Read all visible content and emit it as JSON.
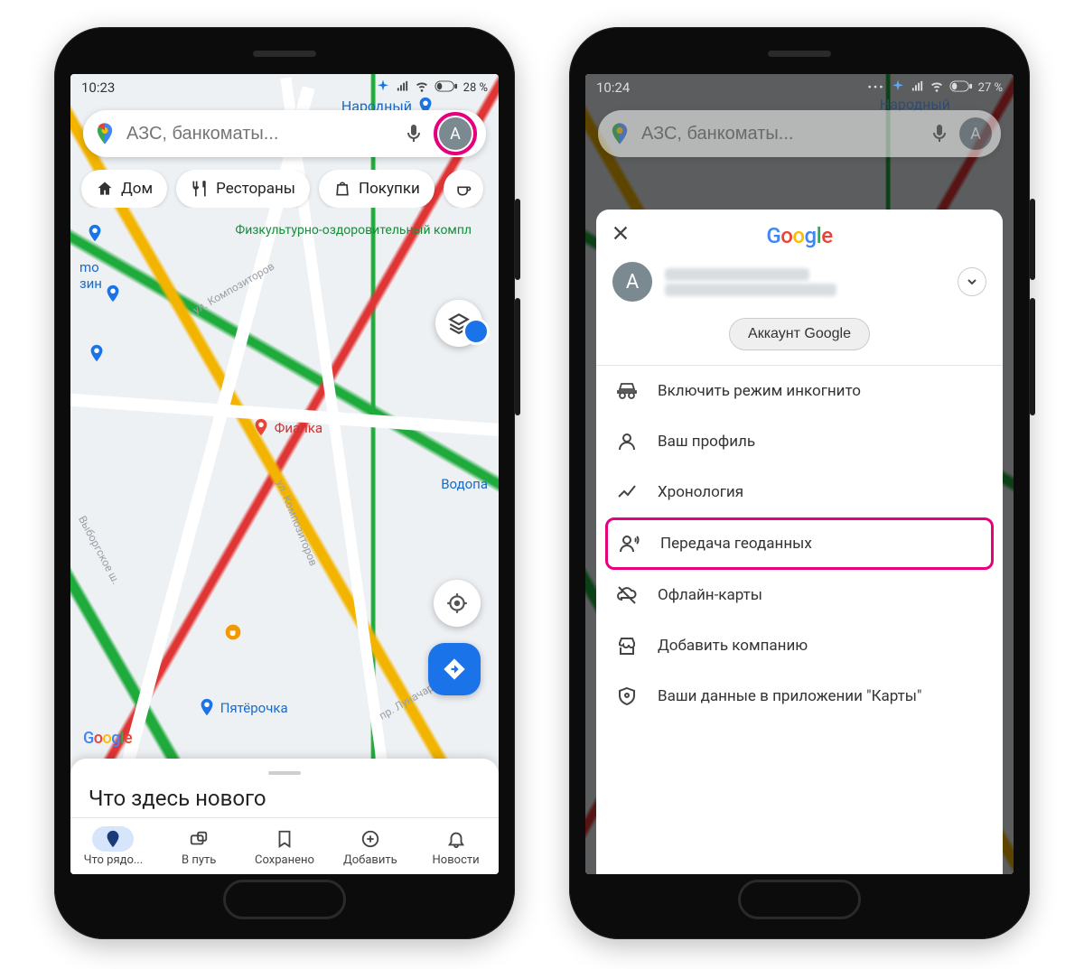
{
  "phone1": {
    "time": "10:23",
    "battery": "28 %",
    "search_placeholder": "АЗС, банкоматы...",
    "avatar_letter": "А",
    "chips": {
      "home": "Дом",
      "restaurants": "Рестораны",
      "shopping": "Покупки"
    },
    "map_labels": {
      "narodny": "Народный",
      "fitness": "Физкультурно-оздоровительный компл",
      "fialka": "Фиалка",
      "vodopa": "Водопа",
      "pyaterochka": "Пятёрочка",
      "mo_shop": "mo\nзин",
      "street1": "ул. Композиторов",
      "street2": "ул. Композиторов",
      "street3": "Выборгское ш.",
      "street4": "пр. Луначарского"
    },
    "card_title": "Что здесь нового",
    "nav": {
      "explore": "Что рядо...",
      "go": "В путь",
      "saved": "Сохранено",
      "contribute": "Добавить",
      "updates": "Новости"
    }
  },
  "phone2": {
    "time": "10:24",
    "battery": "27 %",
    "search_placeholder": "АЗС, банкоматы...",
    "avatar_letter": "А",
    "account_btn": "Аккаунт Google",
    "menu": {
      "incognito": "Включить режим инкогнито",
      "profile": "Ваш профиль",
      "timeline": "Хронология",
      "location_share": "Передача геоданных",
      "offline": "Офлайн-карты",
      "add_business": "Добавить компанию",
      "your_data": "Ваши данные в приложении \"Карты\""
    }
  }
}
